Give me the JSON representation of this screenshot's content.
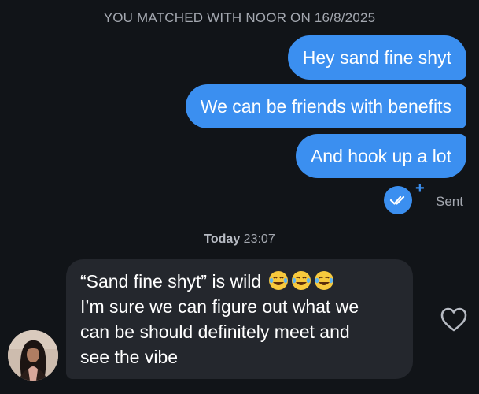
{
  "header": {
    "match_text": "YOU MATCHED WITH NOOR ON 16/8/2025"
  },
  "outgoing_messages": [
    {
      "text": "Hey sand fine shyt"
    },
    {
      "text": "We can be friends with benefits"
    },
    {
      "text": "And hook up a lot"
    }
  ],
  "read_receipt": {
    "icon": "double-check-icon",
    "plus": "+",
    "status": "Sent"
  },
  "timestamp": {
    "day": "Today",
    "time": "23:07"
  },
  "incoming_message": {
    "lines": [
      "“Sand fine shyt” is wild",
      "I’m sure we can figure out what we",
      "can be should definitely meet and",
      "see the vibe"
    ],
    "emoji": [
      "face-with-tears-of-joy",
      "face-with-tears-of-joy",
      "face-with-tears-of-joy"
    ]
  },
  "like_icon": "heart-outline-icon",
  "avatar_icon": "profile-photo",
  "colors": {
    "background": "#111418",
    "outgoing_bubble": "#3b8ff0",
    "incoming_bubble": "#24272d",
    "meta_text": "#a4a8b0"
  }
}
